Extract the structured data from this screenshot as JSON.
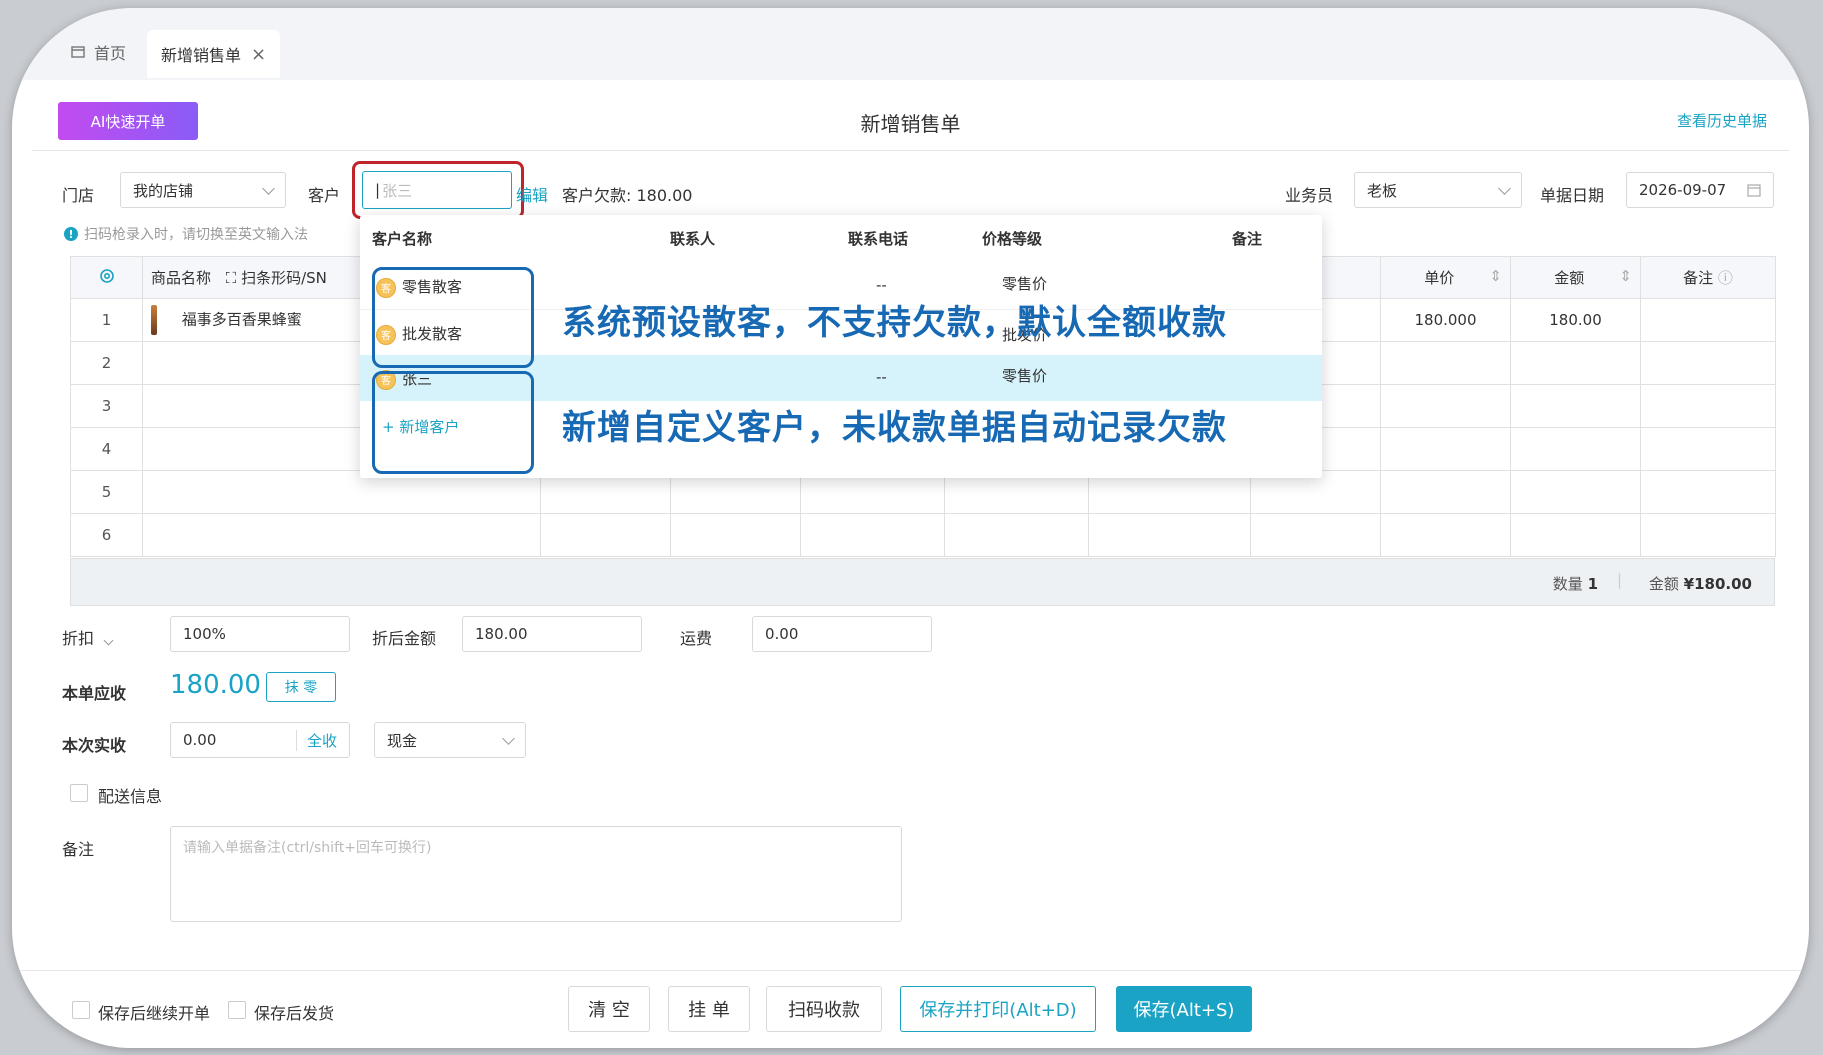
{
  "tabs": {
    "home_label": "首页",
    "active_label": "新增销售单",
    "close_glyph": "×"
  },
  "header": {
    "ai_button": "AI快速开单",
    "title": "新增销售单",
    "history_link": "查看历史单据"
  },
  "form": {
    "store_label": "门店",
    "store_value": "我的店铺",
    "customer_label": "客户",
    "customer_placeholder": "张三",
    "edit_link": "编辑",
    "customer_debt": "客户欠款: 180.00",
    "salesperson_label": "业务员",
    "salesperson_value": "老板",
    "date_label": "单据日期",
    "date_value": "2026-09-07",
    "scan_hint": "扫码枪录入时，请切换至英文输入法"
  },
  "table": {
    "headers": {
      "product": "商品名称",
      "scan": "扫条形码/SN",
      "unit_price": "单价",
      "amount": "金额",
      "remark": "备注"
    },
    "rows": [
      {
        "no": "1",
        "product": "福事多百香果蜂蜜",
        "unit_price": "180.000",
        "amount": "180.00"
      },
      {
        "no": "2"
      },
      {
        "no": "3"
      },
      {
        "no": "4"
      },
      {
        "no": "5"
      },
      {
        "no": "6"
      }
    ],
    "summary": {
      "qty_label": "数量",
      "qty_value": "1",
      "total_label": "金额",
      "total_value": "¥180.00"
    }
  },
  "dropdown": {
    "headers": {
      "name": "客户名称",
      "contact": "联系人",
      "phone": "联系电话",
      "price_level": "价格等级",
      "remark": "备注"
    },
    "rows": [
      {
        "icon": "客",
        "name": "零售散客",
        "contact": "--",
        "price_level": "零售价"
      },
      {
        "icon": "客",
        "name": "批发散客",
        "contact": "--",
        "price_level": "批发价"
      },
      {
        "icon": "客",
        "name": "张三",
        "contact": "--",
        "price_level": "零售价"
      }
    ],
    "add_customer": "+ 新增客户"
  },
  "annotations": {
    "preset": "系统预设散客，不支持欠款，默认全额收款",
    "custom": "新增自定义客户，未收款单据自动记录欠款"
  },
  "payment": {
    "discount_label": "折扣",
    "discount_value": "100%",
    "discounted_label": "折后金额",
    "discounted_value": "180.00",
    "freight_label": "运费",
    "freight_value": "0.00",
    "receivable_label": "本单应收",
    "receivable_value": "180.00",
    "round_button": "抹 零",
    "received_label": "本次实收",
    "received_value": "0.00",
    "full_receive": "全收",
    "method_value": "现金",
    "delivery_label": "配送信息",
    "remark_label": "备注",
    "remark_placeholder": "请输入单据备注(ctrl/shift+回车可换行)"
  },
  "footer": {
    "continue_label": "保存后继续开单",
    "ship_label": "保存后发货",
    "clear": "清 空",
    "hold": "挂 单",
    "scan_pay": "扫码收款",
    "save_print": "保存并打印(Alt+D)",
    "save": "保存(Alt+S)"
  },
  "colors": {
    "accent": "#1aa3c4",
    "annotation": "#1769b3",
    "highlight_ring": "#c0242b"
  }
}
